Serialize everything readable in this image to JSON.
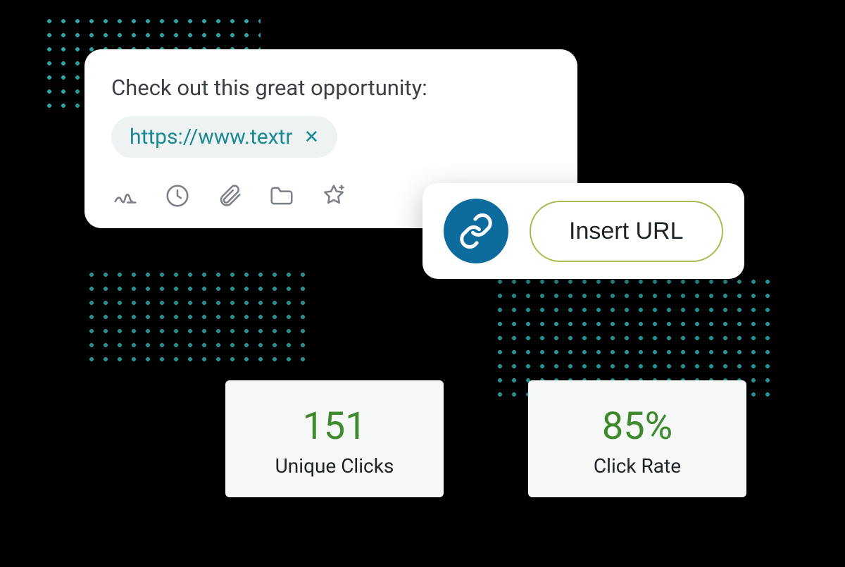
{
  "composer": {
    "message_text": "Check out this great opportunity:",
    "url_chip": {
      "text": "https://www.textr",
      "close_glyph": "✕"
    }
  },
  "insert_url": {
    "button_label": "Insert URL"
  },
  "stats": {
    "unique_clicks": {
      "value": "151",
      "label": "Unique Clicks"
    },
    "click_rate": {
      "value": "85%",
      "label": "Click Rate"
    }
  },
  "colors": {
    "teal": "#1a8a92",
    "blue_circle": "#0e6b9e",
    "olive_border": "#a7bb4f",
    "stat_green": "#3f8a2e"
  }
}
